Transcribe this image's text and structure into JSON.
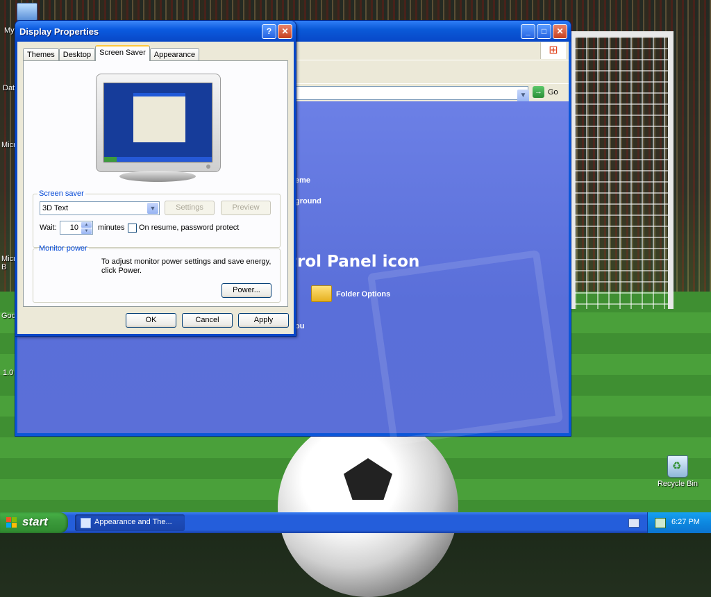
{
  "desktop": {
    "icons": [
      "My",
      "Dat",
      "Micro",
      "Micro B",
      "Goo",
      "1.0"
    ],
    "recycle_bin": "Recycle Bin"
  },
  "explorer": {
    "go_label": "Go",
    "partial_items": [
      "eme",
      "ground",
      "ou"
    ],
    "heading": "trol Panel icon",
    "folder_options": "Folder Options"
  },
  "dialog": {
    "title": "Display Properties",
    "tabs": [
      "Themes",
      "Desktop",
      "Screen Saver",
      "Appearance"
    ],
    "active_tab": "Screen Saver",
    "screen_saver": {
      "group_label": "Screen saver",
      "selected": "3D Text",
      "settings_button": "Settings",
      "preview_button": "Preview",
      "wait_label": "Wait:",
      "wait_value": "10",
      "minutes_label": "minutes",
      "password_protect_label": "On resume, password protect",
      "password_protect_checked": false
    },
    "monitor_power": {
      "group_label": "Monitor power",
      "description": "To adjust monitor power settings and save energy, click Power.",
      "power_button": "Power..."
    },
    "buttons": {
      "ok": "OK",
      "cancel": "Cancel",
      "apply": "Apply"
    }
  },
  "taskbar": {
    "start_label": "start",
    "task_label": "Appearance and The...",
    "clock": "6:27 PM"
  }
}
